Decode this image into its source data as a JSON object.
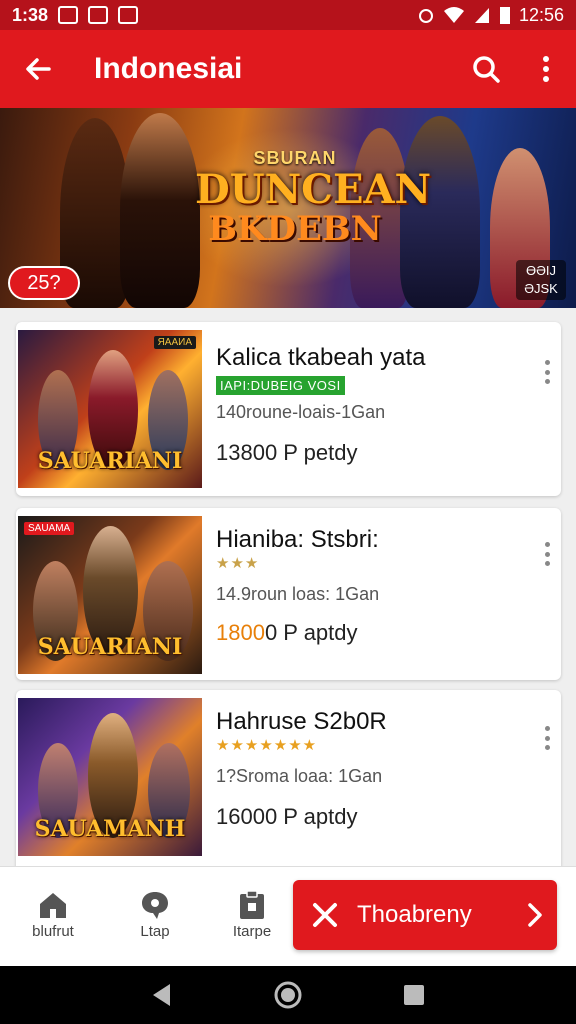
{
  "status": {
    "time": "1:38",
    "right_time": "12:56"
  },
  "appbar": {
    "title": "Indonesiai"
  },
  "banner": {
    "logo_line1": "SBURAN",
    "logo_line2": "DUNCEAN",
    "logo_line3": "BKDEBN",
    "pill": "25?",
    "corner_l1": "ӨƏIJ",
    "corner_l2": "ƏJSK"
  },
  "items": [
    {
      "title": "Kalica tkabeah yata",
      "badge": "IAPI:DUBEIG VOSI",
      "sub": "140roune-loais-1Gan",
      "price": "13800 P petdy",
      "cap": "SAUARIANI",
      "tag": "ЯAAИA"
    },
    {
      "title": "Hianiba: Stsbri:",
      "stars": "★★★",
      "sub": "14.9roun loas: 1Gan",
      "price_highlight": "1800",
      "price_rest": "0 P aptdy",
      "cap": "SAUARIANI",
      "tag": "SAUAMA"
    },
    {
      "title": "Hahruse S2b0R",
      "stars": "★★★★★★★",
      "sub": "1?Sroma loaa: 1Gan",
      "price": "16000 P aptdy",
      "cap": "SAUAMANH"
    }
  ],
  "nav": {
    "home": "blufrut",
    "map": "Ltap",
    "menu": "Itarpe"
  },
  "cta": {
    "label": "Thoabreny"
  },
  "colors": {
    "primary": "#e0191e",
    "status": "#b5121b",
    "badge_green": "#27a32f",
    "price_orange": "#e8800a"
  }
}
